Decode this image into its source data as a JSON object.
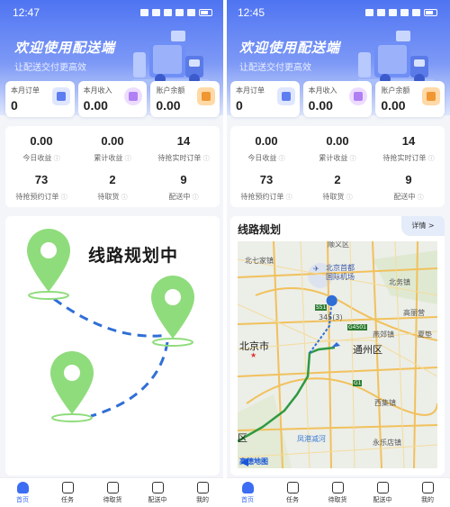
{
  "left": {
    "status": {
      "time": "12:47"
    },
    "header": {
      "welcome": "欢迎使用配送端",
      "subtitle": "让配送交付更高效"
    },
    "cards": [
      {
        "label": "本月订单",
        "value": "0"
      },
      {
        "label": "本月收入",
        "value": "0.00"
      },
      {
        "label": "账户余额",
        "value": "0.00"
      }
    ],
    "stats": [
      {
        "value": "0.00",
        "label": "今日收益"
      },
      {
        "value": "0.00",
        "label": "累计收益"
      },
      {
        "value": "14",
        "label": "待抢实时订单"
      },
      {
        "value": "73",
        "label": "待抢预约订单"
      },
      {
        "value": "2",
        "label": "待取货"
      },
      {
        "value": "9",
        "label": "配送中"
      }
    ],
    "planning_text": "线路规划中"
  },
  "right": {
    "status": {
      "time": "12:45"
    },
    "header": {
      "welcome": "欢迎使用配送端",
      "subtitle": "让配送交付更高效"
    },
    "cards": [
      {
        "label": "本月订单",
        "value": "0"
      },
      {
        "label": "本月收入",
        "value": "0.00"
      },
      {
        "label": "账户余额",
        "value": "0.00"
      }
    ],
    "stats": [
      {
        "value": "0.00",
        "label": "今日收益"
      },
      {
        "value": "0.00",
        "label": "累计收益"
      },
      {
        "value": "14",
        "label": "待抢实时订单"
      },
      {
        "value": "73",
        "label": "待抢预约订单"
      },
      {
        "value": "2",
        "label": "待取货"
      },
      {
        "value": "9",
        "label": "配送中"
      }
    ],
    "route": {
      "title": "线路规划",
      "detail": "详情 >",
      "map_labels": {
        "shunyi": "顺义区",
        "beiqijia": "北七家镇",
        "airport1": "北京首都",
        "airport2": "国际机场",
        "beiwu": "北务镇",
        "gaoliying": "高丽营",
        "s51": "S51",
        "g4501": "G4501",
        "g1": "G1",
        "count": "345(3)",
        "yanjiao": "燕郊镇",
        "xiadian": "夏垫",
        "beijing": "北京市",
        "tongzhou": "通州区",
        "xiji": "西集镇",
        "fengtai": "区",
        "yongle": "永乐店镇",
        "huanggang": "凤港减河",
        "amap": "高德地图"
      }
    }
  },
  "tabs": [
    {
      "label": "首页",
      "icon": "home-icon"
    },
    {
      "label": "任务",
      "icon": "send-icon"
    },
    {
      "label": "待取货",
      "icon": "package-icon"
    },
    {
      "label": "配送中",
      "icon": "delivering-icon"
    },
    {
      "label": "我的",
      "icon": "user-icon"
    }
  ],
  "colors": {
    "accent": "#3d6df2",
    "pin": "#8fdc7c",
    "route": "#2f6fd6"
  }
}
